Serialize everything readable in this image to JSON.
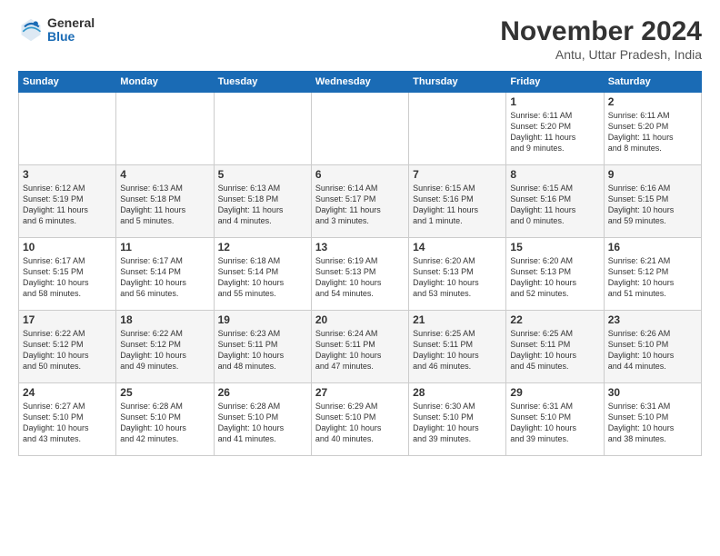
{
  "logo": {
    "general": "General",
    "blue": "Blue"
  },
  "title": "November 2024",
  "subtitle": "Antu, Uttar Pradesh, India",
  "headers": [
    "Sunday",
    "Monday",
    "Tuesday",
    "Wednesday",
    "Thursday",
    "Friday",
    "Saturday"
  ],
  "weeks": [
    [
      {
        "day": "",
        "info": ""
      },
      {
        "day": "",
        "info": ""
      },
      {
        "day": "",
        "info": ""
      },
      {
        "day": "",
        "info": ""
      },
      {
        "day": "",
        "info": ""
      },
      {
        "day": "1",
        "info": "Sunrise: 6:11 AM\nSunset: 5:20 PM\nDaylight: 11 hours\nand 9 minutes."
      },
      {
        "day": "2",
        "info": "Sunrise: 6:11 AM\nSunset: 5:20 PM\nDaylight: 11 hours\nand 8 minutes."
      }
    ],
    [
      {
        "day": "3",
        "info": "Sunrise: 6:12 AM\nSunset: 5:19 PM\nDaylight: 11 hours\nand 6 minutes."
      },
      {
        "day": "4",
        "info": "Sunrise: 6:13 AM\nSunset: 5:18 PM\nDaylight: 11 hours\nand 5 minutes."
      },
      {
        "day": "5",
        "info": "Sunrise: 6:13 AM\nSunset: 5:18 PM\nDaylight: 11 hours\nand 4 minutes."
      },
      {
        "day": "6",
        "info": "Sunrise: 6:14 AM\nSunset: 5:17 PM\nDaylight: 11 hours\nand 3 minutes."
      },
      {
        "day": "7",
        "info": "Sunrise: 6:15 AM\nSunset: 5:16 PM\nDaylight: 11 hours\nand 1 minute."
      },
      {
        "day": "8",
        "info": "Sunrise: 6:15 AM\nSunset: 5:16 PM\nDaylight: 11 hours\nand 0 minutes."
      },
      {
        "day": "9",
        "info": "Sunrise: 6:16 AM\nSunset: 5:15 PM\nDaylight: 10 hours\nand 59 minutes."
      }
    ],
    [
      {
        "day": "10",
        "info": "Sunrise: 6:17 AM\nSunset: 5:15 PM\nDaylight: 10 hours\nand 58 minutes."
      },
      {
        "day": "11",
        "info": "Sunrise: 6:17 AM\nSunset: 5:14 PM\nDaylight: 10 hours\nand 56 minutes."
      },
      {
        "day": "12",
        "info": "Sunrise: 6:18 AM\nSunset: 5:14 PM\nDaylight: 10 hours\nand 55 minutes."
      },
      {
        "day": "13",
        "info": "Sunrise: 6:19 AM\nSunset: 5:13 PM\nDaylight: 10 hours\nand 54 minutes."
      },
      {
        "day": "14",
        "info": "Sunrise: 6:20 AM\nSunset: 5:13 PM\nDaylight: 10 hours\nand 53 minutes."
      },
      {
        "day": "15",
        "info": "Sunrise: 6:20 AM\nSunset: 5:13 PM\nDaylight: 10 hours\nand 52 minutes."
      },
      {
        "day": "16",
        "info": "Sunrise: 6:21 AM\nSunset: 5:12 PM\nDaylight: 10 hours\nand 51 minutes."
      }
    ],
    [
      {
        "day": "17",
        "info": "Sunrise: 6:22 AM\nSunset: 5:12 PM\nDaylight: 10 hours\nand 50 minutes."
      },
      {
        "day": "18",
        "info": "Sunrise: 6:22 AM\nSunset: 5:12 PM\nDaylight: 10 hours\nand 49 minutes."
      },
      {
        "day": "19",
        "info": "Sunrise: 6:23 AM\nSunset: 5:11 PM\nDaylight: 10 hours\nand 48 minutes."
      },
      {
        "day": "20",
        "info": "Sunrise: 6:24 AM\nSunset: 5:11 PM\nDaylight: 10 hours\nand 47 minutes."
      },
      {
        "day": "21",
        "info": "Sunrise: 6:25 AM\nSunset: 5:11 PM\nDaylight: 10 hours\nand 46 minutes."
      },
      {
        "day": "22",
        "info": "Sunrise: 6:25 AM\nSunset: 5:11 PM\nDaylight: 10 hours\nand 45 minutes."
      },
      {
        "day": "23",
        "info": "Sunrise: 6:26 AM\nSunset: 5:10 PM\nDaylight: 10 hours\nand 44 minutes."
      }
    ],
    [
      {
        "day": "24",
        "info": "Sunrise: 6:27 AM\nSunset: 5:10 PM\nDaylight: 10 hours\nand 43 minutes."
      },
      {
        "day": "25",
        "info": "Sunrise: 6:28 AM\nSunset: 5:10 PM\nDaylight: 10 hours\nand 42 minutes."
      },
      {
        "day": "26",
        "info": "Sunrise: 6:28 AM\nSunset: 5:10 PM\nDaylight: 10 hours\nand 41 minutes."
      },
      {
        "day": "27",
        "info": "Sunrise: 6:29 AM\nSunset: 5:10 PM\nDaylight: 10 hours\nand 40 minutes."
      },
      {
        "day": "28",
        "info": "Sunrise: 6:30 AM\nSunset: 5:10 PM\nDaylight: 10 hours\nand 39 minutes."
      },
      {
        "day": "29",
        "info": "Sunrise: 6:31 AM\nSunset: 5:10 PM\nDaylight: 10 hours\nand 39 minutes."
      },
      {
        "day": "30",
        "info": "Sunrise: 6:31 AM\nSunset: 5:10 PM\nDaylight: 10 hours\nand 38 minutes."
      }
    ]
  ]
}
